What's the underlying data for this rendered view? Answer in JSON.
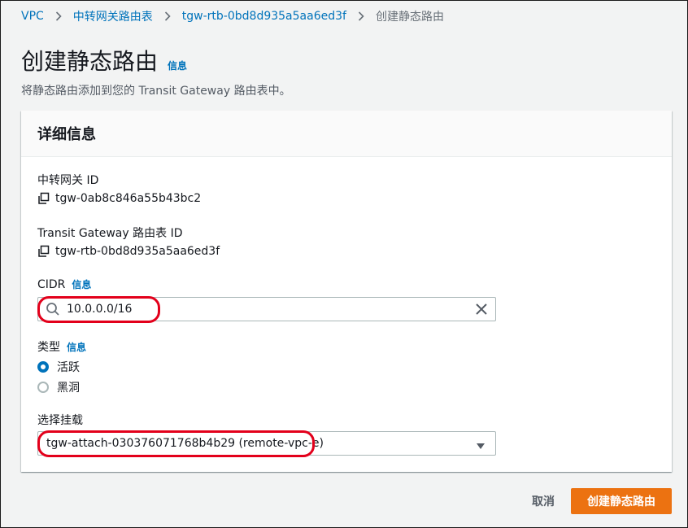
{
  "breadcrumb": {
    "items": [
      "VPC",
      "中转网关路由表",
      "tgw-rtb-0bd8d935a5aa6ed3f"
    ],
    "current": "创建静态路由"
  },
  "header": {
    "title": "创建静态路由",
    "info": "信息",
    "description": "将静态路由添加到您的 Transit Gateway 路由表中。"
  },
  "panel": {
    "title": "详细信息",
    "tgw_id_label": "中转网关 ID",
    "tgw_id_value": "tgw-0ab8c846a55b43bc2",
    "rtb_id_label": "Transit Gateway 路由表 ID",
    "rtb_id_value": "tgw-rtb-0bd8d935a5aa6ed3f",
    "cidr_label": "CIDR",
    "cidr_info": "信息",
    "cidr_value": "10.0.0.0/16",
    "type_label": "类型",
    "type_info": "信息",
    "type_options": [
      {
        "label": "活跃",
        "selected": true
      },
      {
        "label": "黑洞",
        "selected": false
      }
    ],
    "attachment_label": "选择挂载",
    "attachment_value": "tgw-attach-030376071768b4b29 (remote-vpc-e)"
  },
  "actions": {
    "cancel": "取消",
    "submit": "创建静态路由"
  },
  "colors": {
    "link": "#0073bb",
    "primary": "#ec7211",
    "highlight": "#e3001b"
  },
  "icons": [
    "chevron-right-icon",
    "copy-icon",
    "search-icon",
    "clear-icon",
    "caret-down-icon"
  ]
}
